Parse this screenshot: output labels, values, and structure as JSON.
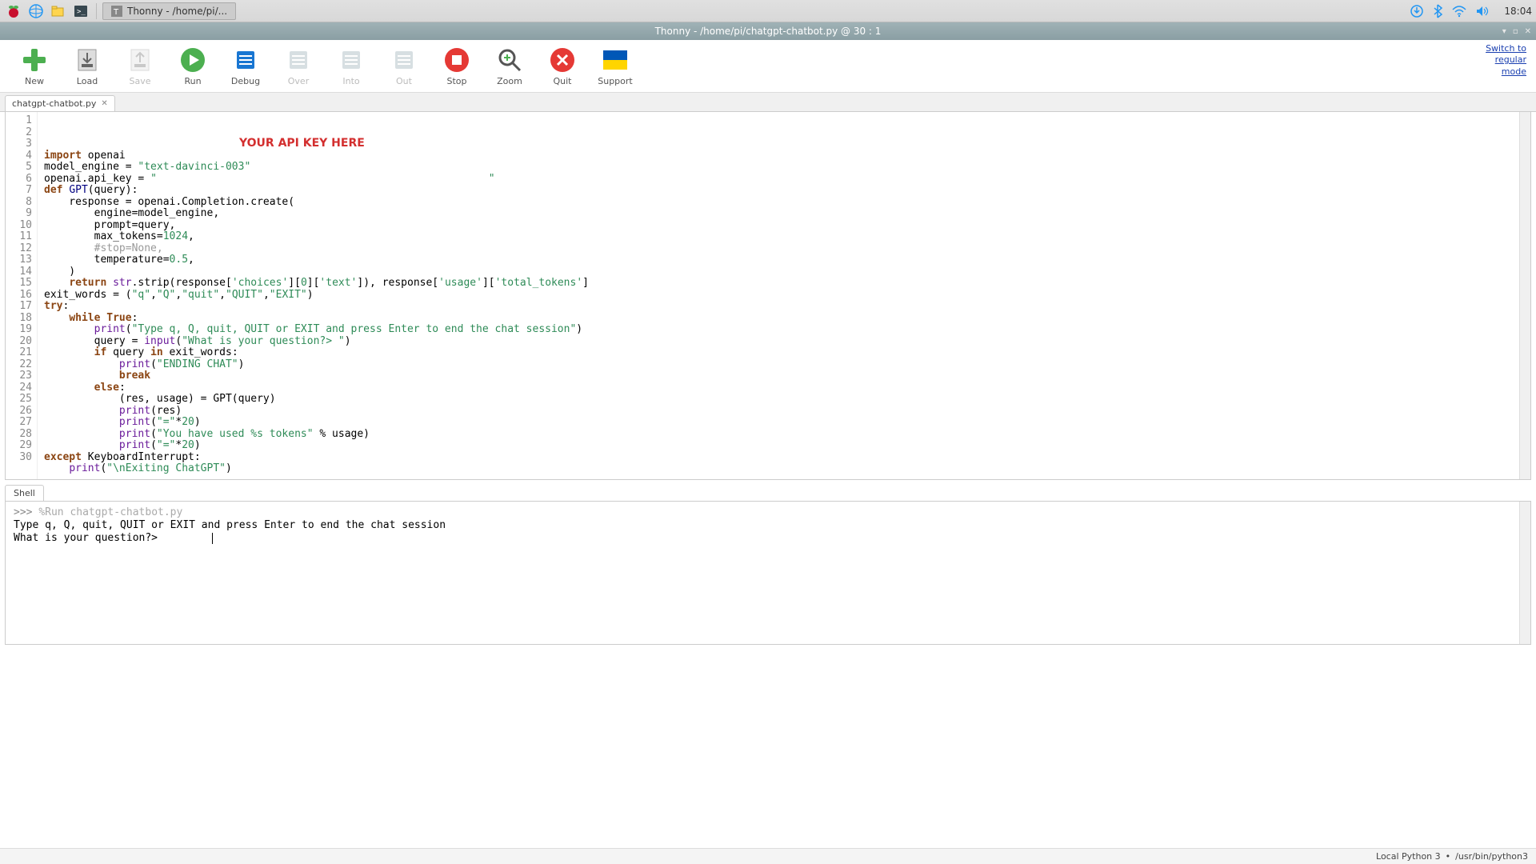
{
  "taskbar": {
    "app_label": "Thonny  -  /home/pi/...",
    "clock": "18:04"
  },
  "titlebar": {
    "text": "Thonny  -  /home/pi/chatgpt-chatbot.py  @  30 : 1"
  },
  "toolbar": {
    "new": "New",
    "load": "Load",
    "save": "Save",
    "run": "Run",
    "debug": "Debug",
    "over": "Over",
    "into": "Into",
    "out": "Out",
    "stop": "Stop",
    "zoom": "Zoom",
    "quit": "Quit",
    "support": "Support",
    "switch_link": "Switch to\nregular\nmode"
  },
  "editor": {
    "tab_name": "chatgpt-chatbot.py",
    "api_overlay": "YOUR API KEY HERE",
    "line_count": 30,
    "code_lines": [
      {
        "n": 1,
        "t": [
          [
            "kw",
            "import"
          ],
          [
            "",
            " openai"
          ]
        ]
      },
      {
        "n": 2,
        "t": [
          [
            "",
            "model_engine = "
          ],
          [
            "str",
            "\"text-davinci-003\""
          ]
        ]
      },
      {
        "n": 3,
        "t": [
          [
            "",
            "openai.api_key = "
          ],
          [
            "str",
            "\"                                                     \""
          ]
        ]
      },
      {
        "n": 4,
        "t": [
          [
            "kw",
            "def"
          ],
          [
            "",
            " "
          ],
          [
            "fn",
            "GPT"
          ],
          [
            "",
            "(query):"
          ]
        ]
      },
      {
        "n": 5,
        "t": [
          [
            "",
            "    response = openai.Completion.create("
          ]
        ]
      },
      {
        "n": 6,
        "t": [
          [
            "",
            "        engine=model_engine,"
          ]
        ]
      },
      {
        "n": 7,
        "t": [
          [
            "",
            "        prompt=query,"
          ]
        ]
      },
      {
        "n": 8,
        "t": [
          [
            "",
            "        max_tokens="
          ],
          [
            "num",
            "1024"
          ],
          [
            "",
            ","
          ]
        ]
      },
      {
        "n": 9,
        "t": [
          [
            "com",
            "        #stop=None,"
          ]
        ]
      },
      {
        "n": 10,
        "t": [
          [
            "",
            "        temperature="
          ],
          [
            "num",
            "0.5"
          ],
          [
            "",
            ","
          ]
        ]
      },
      {
        "n": 11,
        "t": [
          [
            "",
            "    )"
          ]
        ]
      },
      {
        "n": 12,
        "t": [
          [
            "",
            "    "
          ],
          [
            "kw",
            "return"
          ],
          [
            "",
            " "
          ],
          [
            "bi",
            "str"
          ],
          [
            "",
            ".strip(response["
          ],
          [
            "str",
            "'choices'"
          ],
          [
            "",
            "]["
          ],
          [
            "num",
            "0"
          ],
          [
            "",
            "]["
          ],
          [
            "str",
            "'text'"
          ],
          [
            "",
            "]), response["
          ],
          [
            "str",
            "'usage'"
          ],
          [
            "",
            "]["
          ],
          [
            "str",
            "'total_tokens'"
          ],
          [
            "",
            "]"
          ]
        ]
      },
      {
        "n": 13,
        "t": [
          [
            "",
            ""
          ]
        ]
      },
      {
        "n": 14,
        "t": [
          [
            "",
            "exit_words = ("
          ],
          [
            "str",
            "\"q\""
          ],
          [
            "",
            ","
          ],
          [
            "str",
            "\"Q\""
          ],
          [
            "",
            ","
          ],
          [
            "str",
            "\"quit\""
          ],
          [
            "",
            ","
          ],
          [
            "str",
            "\"QUIT\""
          ],
          [
            "",
            ","
          ],
          [
            "str",
            "\"EXIT\""
          ],
          [
            "",
            ")"
          ]
        ]
      },
      {
        "n": 15,
        "t": [
          [
            "kw",
            "try"
          ],
          [
            "",
            ":"
          ]
        ]
      },
      {
        "n": 16,
        "t": [
          [
            "",
            "    "
          ],
          [
            "kw",
            "while"
          ],
          [
            "",
            " "
          ],
          [
            "kw",
            "True"
          ],
          [
            "",
            ":"
          ]
        ]
      },
      {
        "n": 17,
        "t": [
          [
            "",
            "        "
          ],
          [
            "bi",
            "print"
          ],
          [
            "",
            "("
          ],
          [
            "str",
            "\"Type q, Q, quit, QUIT or EXIT and press Enter to end the chat session\""
          ],
          [
            "",
            ")"
          ]
        ]
      },
      {
        "n": 18,
        "t": [
          [
            "",
            "        query = "
          ],
          [
            "bi",
            "input"
          ],
          [
            "",
            "("
          ],
          [
            "str",
            "\"What is your question?> \""
          ],
          [
            "",
            ")"
          ]
        ]
      },
      {
        "n": 19,
        "t": [
          [
            "",
            "        "
          ],
          [
            "kw",
            "if"
          ],
          [
            "",
            " query "
          ],
          [
            "kw",
            "in"
          ],
          [
            "",
            " exit_words:"
          ]
        ]
      },
      {
        "n": 20,
        "t": [
          [
            "",
            "            "
          ],
          [
            "bi",
            "print"
          ],
          [
            "",
            "("
          ],
          [
            "str",
            "\"ENDING CHAT\""
          ],
          [
            "",
            ")"
          ]
        ]
      },
      {
        "n": 21,
        "t": [
          [
            "",
            "            "
          ],
          [
            "kw",
            "break"
          ]
        ]
      },
      {
        "n": 22,
        "t": [
          [
            "",
            "        "
          ],
          [
            "kw",
            "else"
          ],
          [
            "",
            ":"
          ]
        ]
      },
      {
        "n": 23,
        "t": [
          [
            "",
            "            (res, usage) = GPT(query)"
          ]
        ]
      },
      {
        "n": 24,
        "t": [
          [
            "",
            "            "
          ],
          [
            "bi",
            "print"
          ],
          [
            "",
            "(res)"
          ]
        ]
      },
      {
        "n": 25,
        "t": [
          [
            "",
            "            "
          ],
          [
            "bi",
            "print"
          ],
          [
            "",
            "("
          ],
          [
            "str",
            "\"=\""
          ],
          [
            "",
            "*"
          ],
          [
            "num",
            "20"
          ],
          [
            "",
            ")"
          ]
        ]
      },
      {
        "n": 26,
        "t": [
          [
            "",
            "            "
          ],
          [
            "bi",
            "print"
          ],
          [
            "",
            "("
          ],
          [
            "str",
            "\"You have used %s tokens\""
          ],
          [
            "",
            " % usage)"
          ]
        ]
      },
      {
        "n": 27,
        "t": [
          [
            "",
            "            "
          ],
          [
            "bi",
            "print"
          ],
          [
            "",
            "("
          ],
          [
            "str",
            "\"=\""
          ],
          [
            "",
            "*"
          ],
          [
            "num",
            "20"
          ],
          [
            "",
            ")"
          ]
        ]
      },
      {
        "n": 28,
        "t": [
          [
            "kw",
            "except"
          ],
          [
            "",
            " KeyboardInterrupt:"
          ]
        ]
      },
      {
        "n": 29,
        "t": [
          [
            "",
            "    "
          ],
          [
            "bi",
            "print"
          ],
          [
            "",
            "("
          ],
          [
            "str",
            "\"\\nExiting ChatGPT\""
          ],
          [
            "",
            ")"
          ]
        ]
      },
      {
        "n": 30,
        "t": [
          [
            "",
            ""
          ]
        ]
      }
    ]
  },
  "shell": {
    "tab": "Shell",
    "prompt": ">>>",
    "run_cmd": "%Run chatgpt-chatbot.py",
    "line1": " Type q, Q, quit, QUIT or EXIT and press Enter to end the chat session",
    "line2": " What is your question?> "
  },
  "statusbar": {
    "interp": "Local Python 3",
    "sep": "•",
    "path": "/usr/bin/python3"
  }
}
